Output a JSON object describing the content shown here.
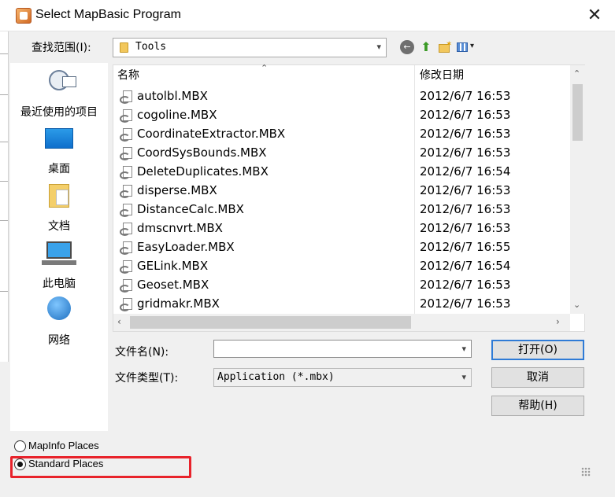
{
  "window": {
    "title": "Select MapBasic Program",
    "close_glyph": "✕"
  },
  "lookin": {
    "label": "查找范围(I):",
    "value": "Tools"
  },
  "toolbar": {
    "back_glyph": "←",
    "up_glyph": "⬆",
    "view_arrow": "▾"
  },
  "places": [
    {
      "label": "最近使用的项目",
      "icon": "recent-places-icon"
    },
    {
      "label": "桌面",
      "icon": "desktop-icon"
    },
    {
      "label": "文档",
      "icon": "documents-icon"
    },
    {
      "label": "此电脑",
      "icon": "this-pc-icon"
    },
    {
      "label": "网络",
      "icon": "network-icon"
    }
  ],
  "filelist": {
    "columns": {
      "name": "名称",
      "date": "修改日期"
    },
    "rows": [
      {
        "name": "autolbl.MBX",
        "date": "2012/6/7 16:53"
      },
      {
        "name": "cogoline.MBX",
        "date": "2012/6/7 16:53"
      },
      {
        "name": "CoordinateExtractor.MBX",
        "date": "2012/6/7 16:53"
      },
      {
        "name": "CoordSysBounds.MBX",
        "date": "2012/6/7 16:53"
      },
      {
        "name": "DeleteDuplicates.MBX",
        "date": "2012/6/7 16:54"
      },
      {
        "name": "disperse.MBX",
        "date": "2012/6/7 16:53"
      },
      {
        "name": "DistanceCalc.MBX",
        "date": "2012/6/7 16:53"
      },
      {
        "name": "dmscnvrt.MBX",
        "date": "2012/6/7 16:53"
      },
      {
        "name": "EasyLoader.MBX",
        "date": "2012/6/7 16:55"
      },
      {
        "name": "GELink.MBX",
        "date": "2012/6/7 16:54"
      },
      {
        "name": "Geoset.MBX",
        "date": "2012/6/7 16:53"
      },
      {
        "name": "gridmakr.MBX",
        "date": "2012/6/7 16:53"
      }
    ]
  },
  "form": {
    "filename_label": "文件名(N):",
    "filename_value": "",
    "filetype_label": "文件类型(T):",
    "filetype_value": "Application (*.mbx)"
  },
  "buttons": {
    "open": "打开(O)",
    "cancel": "取消",
    "help": "帮助(H)"
  },
  "radios": {
    "mapinfo_places": {
      "label": "MapInfo Places",
      "checked": false
    },
    "standard_places": {
      "label": "Standard Places",
      "checked": true
    }
  },
  "colors": {
    "highlight": "#e8232b",
    "focus": "#2f7bd6"
  }
}
